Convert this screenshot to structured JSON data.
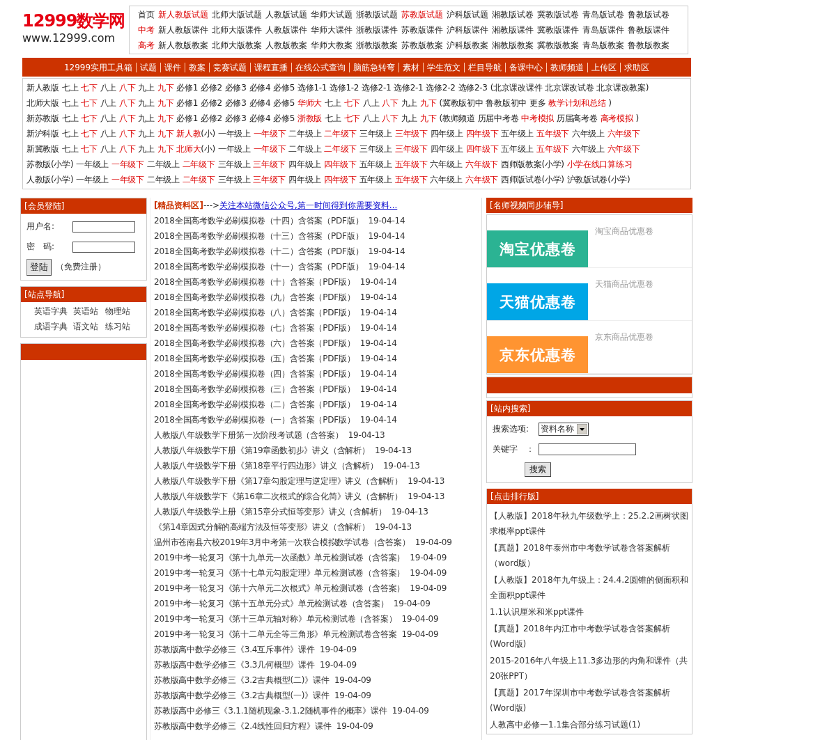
{
  "logo": {
    "name": "12999数学网",
    "url": "www.12999.com"
  },
  "top_links": [
    [
      {
        "text": "首页",
        "hot": false
      },
      {
        "text": "新人教版试题",
        "hot": true
      },
      {
        "text": "北师大版试题",
        "hot": false
      },
      {
        "text": "人教版试题",
        "hot": false
      },
      {
        "text": "华师大试题",
        "hot": false
      },
      {
        "text": "浙教版试题",
        "hot": false
      },
      {
        "text": "苏教版试题",
        "hot": true
      },
      {
        "text": "沪科版试题",
        "hot": false
      },
      {
        "text": "湘教版试卷",
        "hot": false
      },
      {
        "text": "冀教版试卷",
        "hot": false
      },
      {
        "text": "青岛版试卷",
        "hot": false
      },
      {
        "text": "鲁教版试卷",
        "hot": false
      }
    ],
    [
      {
        "text": "中考",
        "hot": true
      },
      {
        "text": "新人教版课件",
        "hot": false
      },
      {
        "text": "北师大版课件",
        "hot": false
      },
      {
        "text": "人教版课件",
        "hot": false
      },
      {
        "text": "华师大课件",
        "hot": false
      },
      {
        "text": "浙教版课件",
        "hot": false
      },
      {
        "text": "苏教版课件",
        "hot": false
      },
      {
        "text": "沪科版课件",
        "hot": false
      },
      {
        "text": "湘教版课件",
        "hot": false
      },
      {
        "text": "冀教版课件",
        "hot": false
      },
      {
        "text": "青岛版课件",
        "hot": false
      },
      {
        "text": "鲁教版课件",
        "hot": false
      }
    ],
    [
      {
        "text": "高考",
        "hot": true
      },
      {
        "text": "新人教版教案",
        "hot": false
      },
      {
        "text": "北师大版教案",
        "hot": false
      },
      {
        "text": "人教版教案",
        "hot": false
      },
      {
        "text": "华师大教案",
        "hot": false
      },
      {
        "text": "浙教版教案",
        "hot": false
      },
      {
        "text": "苏教版教案",
        "hot": false
      },
      {
        "text": "沪科版教案",
        "hot": false
      },
      {
        "text": "湘教版教案",
        "hot": false
      },
      {
        "text": "冀教版教案",
        "hot": false
      },
      {
        "text": "青岛版教案",
        "hot": false
      },
      {
        "text": "鲁教版教案",
        "hot": false
      }
    ]
  ],
  "nav": [
    "12999实用工具箱",
    "试题",
    "课件",
    "教案",
    "竞赛试题",
    "课程直播",
    "在线公式查询",
    "脑筋急转弯",
    "素材",
    "学生范文",
    "栏目导航",
    "备课中心",
    "教师频道",
    "上传区",
    "求助区"
  ],
  "grade_rows": [
    [
      {
        "text": "新人教版",
        "hot": false
      },
      {
        "text": "七上",
        "hot": false
      },
      {
        "text": "七下",
        "hot": true
      },
      {
        "text": "八上",
        "hot": false
      },
      {
        "text": "八下",
        "hot": true
      },
      {
        "text": "九上",
        "hot": false
      },
      {
        "text": "九下",
        "hot": true
      },
      {
        "text": "必修1",
        "hot": false
      },
      {
        "text": "必修2",
        "hot": false
      },
      {
        "text": "必修3",
        "hot": false
      },
      {
        "text": "必修4",
        "hot": false
      },
      {
        "text": "必修5",
        "hot": false
      },
      {
        "text": "选修1-1",
        "hot": false
      },
      {
        "text": "选修1-2",
        "hot": false
      },
      {
        "text": "选修2-1",
        "hot": false
      },
      {
        "text": "选修2-1",
        "hot": false
      },
      {
        "text": "选修2-2",
        "hot": false
      },
      {
        "text": "选修2-3",
        "hot": false
      },
      {
        "text": "(北京课改课件",
        "hot": false
      },
      {
        "text": "北京课改试卷",
        "hot": false
      },
      {
        "text": "北京课改教案)",
        "hot": false
      }
    ],
    [
      {
        "text": "北师大版",
        "hot": false
      },
      {
        "text": "七上",
        "hot": false
      },
      {
        "text": "七下",
        "hot": true
      },
      {
        "text": "八上",
        "hot": false
      },
      {
        "text": "八下",
        "hot": true
      },
      {
        "text": "九上",
        "hot": false
      },
      {
        "text": "九下",
        "hot": true
      },
      {
        "text": "必修1",
        "hot": false
      },
      {
        "text": "必修2",
        "hot": false
      },
      {
        "text": "必修3",
        "hot": false
      },
      {
        "text": "必修4",
        "hot": false
      },
      {
        "text": "必修5",
        "hot": false
      },
      {
        "text": "华师大",
        "hot": true
      },
      {
        "text": "七上",
        "hot": false
      },
      {
        "text": "七下",
        "hot": true
      },
      {
        "text": "八上",
        "hot": false
      },
      {
        "text": "八下",
        "hot": true
      },
      {
        "text": "九上",
        "hot": false
      },
      {
        "text": "九下",
        "hot": true
      },
      {
        "text": "(冀教版初中",
        "hot": false
      },
      {
        "text": "鲁教版初中",
        "hot": false
      },
      {
        "text": "更多",
        "hot": false
      },
      {
        "text": "教学计划和总结",
        "hot": true
      },
      {
        "text": ")",
        "hot": false
      }
    ],
    [
      {
        "text": "新苏教版",
        "hot": false
      },
      {
        "text": "七上",
        "hot": false
      },
      {
        "text": "七下",
        "hot": true
      },
      {
        "text": "八上",
        "hot": false
      },
      {
        "text": "八下",
        "hot": true
      },
      {
        "text": "九上",
        "hot": false
      },
      {
        "text": "九下",
        "hot": true
      },
      {
        "text": "必修1",
        "hot": false
      },
      {
        "text": "必修2",
        "hot": false
      },
      {
        "text": "必修3",
        "hot": false
      },
      {
        "text": "必修4",
        "hot": false
      },
      {
        "text": "必修5",
        "hot": false
      },
      {
        "text": "浙教版",
        "hot": true
      },
      {
        "text": "七上",
        "hot": false
      },
      {
        "text": "七下",
        "hot": true
      },
      {
        "text": "八上",
        "hot": false
      },
      {
        "text": "八下",
        "hot": true
      },
      {
        "text": "九上",
        "hot": false
      },
      {
        "text": "九下",
        "hot": true
      },
      {
        "text": "(教师频道",
        "hot": false
      },
      {
        "text": "历届中考卷",
        "hot": false
      },
      {
        "text": "中考模拟",
        "hot": true
      },
      {
        "text": "历届高考卷",
        "hot": false
      },
      {
        "text": "高考模拟",
        "hot": true
      },
      {
        "text": ")",
        "hot": false
      }
    ],
    [
      {
        "text": "新沪科版",
        "hot": false
      },
      {
        "text": "七上",
        "hot": false
      },
      {
        "text": "七下",
        "hot": true
      },
      {
        "text": "八上",
        "hot": false
      },
      {
        "text": "八下",
        "hot": true
      },
      {
        "text": "九上",
        "hot": false
      },
      {
        "text": "九下",
        "hot": true
      },
      {
        "text": "新人教",
        "hot": true,
        "suffix": "(小)"
      },
      {
        "text": "一年级上",
        "hot": false
      },
      {
        "text": "一年级下",
        "hot": true
      },
      {
        "text": "二年级上",
        "hot": false
      },
      {
        "text": "二年级下",
        "hot": true
      },
      {
        "text": "三年级上",
        "hot": false
      },
      {
        "text": "三年级下",
        "hot": true
      },
      {
        "text": "四年级上",
        "hot": false
      },
      {
        "text": "四年级下",
        "hot": true
      },
      {
        "text": "五年级上",
        "hot": false
      },
      {
        "text": "五年级下",
        "hot": true
      },
      {
        "text": "六年级上",
        "hot": false
      },
      {
        "text": "六年级下",
        "hot": true
      }
    ],
    [
      {
        "text": "新冀教版",
        "hot": false
      },
      {
        "text": "七上",
        "hot": false
      },
      {
        "text": "七下",
        "hot": true
      },
      {
        "text": "八上",
        "hot": false
      },
      {
        "text": "八下",
        "hot": true
      },
      {
        "text": "九上",
        "hot": false
      },
      {
        "text": "九下",
        "hot": true
      },
      {
        "text": "北师大",
        "hot": true,
        "suffix": "(小)"
      },
      {
        "text": "一年级上",
        "hot": false
      },
      {
        "text": "一年级下",
        "hot": true
      },
      {
        "text": "二年级上",
        "hot": false
      },
      {
        "text": "二年级下",
        "hot": true
      },
      {
        "text": "三年级上",
        "hot": false
      },
      {
        "text": "三年级下",
        "hot": true
      },
      {
        "text": "四年级上",
        "hot": false
      },
      {
        "text": "四年级下",
        "hot": true
      },
      {
        "text": "五年级上",
        "hot": false
      },
      {
        "text": "五年级下",
        "hot": true
      },
      {
        "text": "六年级上",
        "hot": false
      },
      {
        "text": "六年级下",
        "hot": true
      }
    ],
    [
      {
        "text": "苏教版(小学)",
        "hot": false
      },
      {
        "text": "一年级上",
        "hot": false
      },
      {
        "text": "一年级下",
        "hot": true
      },
      {
        "text": "二年级上",
        "hot": false
      },
      {
        "text": "二年级下",
        "hot": true
      },
      {
        "text": "三年级上",
        "hot": false
      },
      {
        "text": "三年级下",
        "hot": true
      },
      {
        "text": "四年级上",
        "hot": false
      },
      {
        "text": "四年级下",
        "hot": true
      },
      {
        "text": "五年级上",
        "hot": false
      },
      {
        "text": "五年级下",
        "hot": true
      },
      {
        "text": "六年级上",
        "hot": false
      },
      {
        "text": "六年级下",
        "hot": true
      },
      {
        "text": "西师版教案(小学)",
        "hot": false
      },
      {
        "text": "小学在线口算练习",
        "hot": true
      }
    ],
    [
      {
        "text": "人教版(小学)",
        "hot": false
      },
      {
        "text": "一年级上",
        "hot": false
      },
      {
        "text": "一年级下",
        "hot": true
      },
      {
        "text": "二年级上",
        "hot": false
      },
      {
        "text": "二年级下",
        "hot": true
      },
      {
        "text": "三年级上",
        "hot": false
      },
      {
        "text": "三年级下",
        "hot": true
      },
      {
        "text": "四年级上",
        "hot": false
      },
      {
        "text": "四年级下",
        "hot": true
      },
      {
        "text": "五年级上",
        "hot": false
      },
      {
        "text": "五年级下",
        "hot": true
      },
      {
        "text": "六年级上",
        "hot": false
      },
      {
        "text": "六年级下",
        "hot": true
      },
      {
        "text": "西师版试卷(小学)",
        "hot": false
      },
      {
        "text": "沪教版试卷(小学)",
        "hot": false
      }
    ]
  ],
  "login": {
    "title": "[会员登陆]",
    "user_label": "用户名:",
    "pass_label": "密　码:",
    "button": "登陆",
    "register": "（免费注册）"
  },
  "site_nav": {
    "title": "[站点导航]",
    "links": [
      "英语字典",
      "英语站",
      "物理站",
      "成语字典",
      "语文站",
      "练习站"
    ]
  },
  "featured": {
    "title": "[精品资料区]",
    "arrow": "--->",
    "notice": "关注本站微信公众号,第一时间得到你需要资料...",
    "articles": [
      {
        "title": "2018全国高考数学必刷模拟卷（十四）含答案（PDF版）",
        "date": "19-04-14"
      },
      {
        "title": "2018全国高考数学必刷模拟卷（十三）含答案（PDF版）",
        "date": "19-04-14"
      },
      {
        "title": "2018全国高考数学必刷模拟卷（十二）含答案（PDF版）",
        "date": "19-04-14"
      },
      {
        "title": "2018全国高考数学必刷模拟卷（十一）含答案（PDF版）",
        "date": "19-04-14"
      },
      {
        "title": "2018全国高考数学必刷模拟卷（十）含答案（PDF版）",
        "date": "19-04-14"
      },
      {
        "title": "2018全国高考数学必刷模拟卷（九）含答案（PDF版）",
        "date": "19-04-14"
      },
      {
        "title": "2018全国高考数学必刷模拟卷（八）含答案（PDF版）",
        "date": "19-04-14"
      },
      {
        "title": "2018全国高考数学必刷模拟卷（七）含答案（PDF版）",
        "date": "19-04-14"
      },
      {
        "title": "2018全国高考数学必刷模拟卷（六）含答案（PDF版）",
        "date": "19-04-14"
      },
      {
        "title": "2018全国高考数学必刷模拟卷（五）含答案（PDF版）",
        "date": "19-04-14"
      },
      {
        "title": "2018全国高考数学必刷模拟卷（四）含答案（PDF版）",
        "date": "19-04-14"
      },
      {
        "title": "2018全国高考数学必刷模拟卷（三）含答案（PDF版）",
        "date": "19-04-14"
      },
      {
        "title": "2018全国高考数学必刷模拟卷（二）含答案（PDF版）",
        "date": "19-04-14"
      },
      {
        "title": "2018全国高考数学必刷模拟卷（一）含答案（PDF版）",
        "date": "19-04-14"
      },
      {
        "title": "人教版八年级数学下册第一次阶段考试题（含答案）",
        "date": "19-04-13"
      },
      {
        "title": "人教版八年级数学下册《第19章函数初步》讲义（含解析）",
        "date": "19-04-13"
      },
      {
        "title": "人教版八年级数学下册《第18章平行四边形》讲义（含解析）",
        "date": "19-04-13"
      },
      {
        "title": "人教版八年级数学下册《第17章勾股定理与逆定理》讲义（含解析）",
        "date": "19-04-13"
      },
      {
        "title": "人教版八年级数学下《第16章二次根式的综合化简》讲义（含解析）",
        "date": "19-04-13"
      },
      {
        "title": "人教版八年级数学上册《第15章分式恒等变形》讲义（含解析）",
        "date": "19-04-13"
      },
      {
        "title": "《第14章因式分解的高端方法及恒等变形》讲义（含解析）",
        "date": "19-04-13"
      },
      {
        "title": "温州市苍南县六校2019年3月中考第一次联合模拟数学试卷（含答案）",
        "date": "19-04-09"
      },
      {
        "title": "2019中考一轮复习《第十九单元一次函数》单元检测试卷（含答案）",
        "date": "19-04-09"
      },
      {
        "title": "2019中考一轮复习《第十七单元勾股定理》单元检测试卷（含答案）",
        "date": "19-04-09"
      },
      {
        "title": "2019中考一轮复习《第十六单元二次根式》单元检测试卷（含答案）",
        "date": "19-04-09"
      },
      {
        "title": "2019中考一轮复习《第十五单元分式》单元检测试卷（含答案）",
        "date": "19-04-09"
      },
      {
        "title": "2019中考一轮复习《第十三单元轴对称》单元检测试卷（含答案）",
        "date": "19-04-09"
      },
      {
        "title": "2019中考一轮复习《第十二单元全等三角形》单元检测试卷含答案",
        "date": "19-04-09"
      },
      {
        "title": "苏教版高中数学必修三《3.4互斥事件》课件",
        "date": "19-04-09"
      },
      {
        "title": "苏教版高中数学必修三《3.3几何概型》课件",
        "date": "19-04-09"
      },
      {
        "title": "苏教版高中数学必修三《3.2古典概型(二)》课件",
        "date": "19-04-09"
      },
      {
        "title": "苏教版高中数学必修三《3.2古典概型(一)》课件",
        "date": "19-04-09"
      },
      {
        "title": "苏教版高中必修三《3.1.1随机现象-3.1.2随机事件的概率》课件",
        "date": "19-04-09"
      },
      {
        "title": "苏教版高中数学必修三《2.4线性回归方程》课件",
        "date": "19-04-09"
      }
    ]
  },
  "tutoring": {
    "title": "[名师视频同步辅导]",
    "coupons": [
      {
        "banner": "淘宝优惠卷",
        "caption": "淘宝商品优惠卷",
        "color": "#2bb393"
      },
      {
        "banner": "天猫优惠卷",
        "caption": "天猫商品优惠卷",
        "color": "#00a6e6"
      },
      {
        "banner": "京东优惠卷",
        "caption": "京东商品优惠卷",
        "color": "#ff9431"
      }
    ]
  },
  "search": {
    "title": "[站内搜索]",
    "option_label": "搜索选项:",
    "option_value": "资料名称",
    "keyword_label": "关键字　：",
    "button": "搜索"
  },
  "ranking": {
    "title": "[点击排行版]",
    "items": [
      "【人教版】2018年秋九年级数学上：25.2.2画树状图求概率ppt课件",
      "【真题】2018年泰州市中考数学试卷含答案解析（word版）",
      "【人教版】2018年九年级上：24.4.2圆锥的侧面积和全面积ppt课件",
      "1.1认识厘米和米ppt课件",
      "【真题】2018年内江市中考数学试卷含答案解析(Word版)",
      "2015-2016年八年级上11.3多边形的内角和课件（共20张PPT）",
      "【真题】2017年深圳市中考数学试卷含答案解析(Word版)",
      "人教高中必修一1.1集合部分练习试题(1)"
    ]
  }
}
